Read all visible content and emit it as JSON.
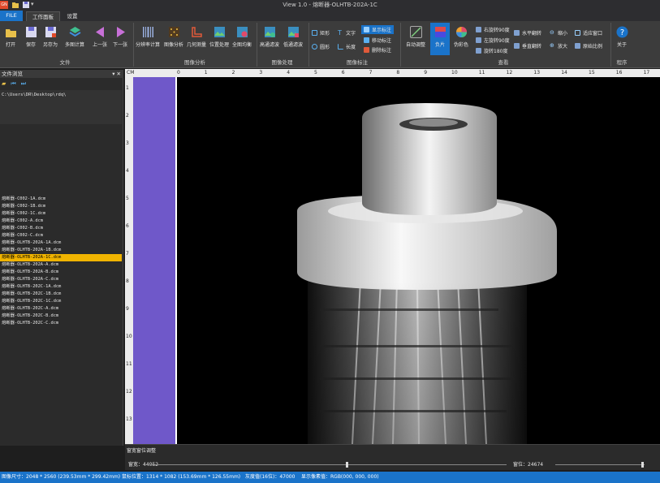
{
  "app": {
    "title": "View 1.0 - 熔断器-OLHTB-202A-1C",
    "logo_text": "GN"
  },
  "tabs": [
    {
      "label": "FILE"
    },
    {
      "label": "工作面板"
    },
    {
      "label": "设置"
    }
  ],
  "ribbon": {
    "file_group": {
      "label": "文件",
      "buttons": [
        {
          "label": "打开",
          "icon": "folder-open-icon"
        },
        {
          "label": "保存",
          "icon": "save-icon"
        },
        {
          "label": "另存为",
          "icon": "save-as-icon"
        },
        {
          "label": "多图计算",
          "icon": "layers-icon"
        },
        {
          "label": "上一张",
          "icon": "prev-icon"
        },
        {
          "label": "下一张",
          "icon": "next-icon"
        }
      ]
    },
    "analysis_group": {
      "label": "图像分析",
      "buttons": [
        {
          "label": "分辨率计算",
          "icon": "barcode-icon"
        },
        {
          "label": "图像分析",
          "icon": "grid-icon"
        },
        {
          "label": "几何测量",
          "icon": "ruler-icon"
        },
        {
          "label": "位置处理",
          "icon": "image-icon"
        },
        {
          "label": "全图均衡",
          "icon": "equalize-icon"
        }
      ]
    },
    "processing_group": {
      "label": "图像处理",
      "buttons": [
        {
          "label": "高通滤波",
          "icon": "highpass-icon"
        },
        {
          "label": "低通滤波",
          "icon": "lowpass-icon"
        }
      ]
    },
    "annotation_group": {
      "label": "图像标注",
      "items": [
        {
          "label": "矩形"
        },
        {
          "label": "圆形"
        },
        {
          "label": "文字"
        },
        {
          "label": "长度"
        },
        {
          "label": "显示标注"
        },
        {
          "label": "移动标注"
        },
        {
          "label": "删除标注"
        }
      ]
    },
    "view_group": {
      "label": "查看",
      "auto_adjust": "自动调整",
      "negative": "负片",
      "pseudo_color": "伪彩色",
      "items": [
        {
          "label": "右旋转90度"
        },
        {
          "label": "左旋转90度"
        },
        {
          "label": "旋转180度"
        },
        {
          "label": "水平翻转"
        },
        {
          "label": "垂直翻转"
        },
        {
          "label": "缩小"
        },
        {
          "label": "放大"
        },
        {
          "label": "适应窗口"
        },
        {
          "label": "原始比例"
        }
      ]
    },
    "program_group": {
      "label": "程序",
      "about": "关于"
    }
  },
  "file_panel": {
    "title": "文件浏览",
    "path": "C:\\Users\\DR\\Desktop\\rdq\\",
    "files": [
      {
        "name": "熔断器-C002-1A.dcm",
        "selected": false
      },
      {
        "name": "熔断器-C002-1B.dcm",
        "selected": false
      },
      {
        "name": "熔断器-C002-1C.dcm",
        "selected": false
      },
      {
        "name": "熔断器-C002-A.dcm",
        "selected": false
      },
      {
        "name": "熔断器-C002-B.dcm",
        "selected": false
      },
      {
        "name": "熔断器-C002-C.dcm",
        "selected": false
      },
      {
        "name": "熔断器-OLHTB-202A-1A.dcm",
        "selected": false
      },
      {
        "name": "熔断器-OLHTB-202A-1B.dcm",
        "selected": false
      },
      {
        "name": "熔断器-OLHTB-202A-1C.dcm",
        "selected": true
      },
      {
        "name": "熔断器-OLHTB-202A-A.dcm",
        "selected": false
      },
      {
        "name": "熔断器-OLHTB-202A-B.dcm",
        "selected": false
      },
      {
        "name": "熔断器-OLHTB-202A-C.dcm",
        "selected": false
      },
      {
        "name": "熔断器-OLHTB-202C-1A.dcm",
        "selected": false
      },
      {
        "name": "熔断器-OLHTB-202C-1B.dcm",
        "selected": false
      },
      {
        "name": "熔断器-OLHTB-202C-1C.dcm",
        "selected": false
      },
      {
        "name": "熔断器-OLHTB-202C-A.dcm",
        "selected": false
      },
      {
        "name": "熔断器-OLHTB-202C-B.dcm",
        "selected": false
      },
      {
        "name": "熔断器-OLHTB-202C-C.dcm",
        "selected": false
      }
    ]
  },
  "ruler": {
    "unit": "CM",
    "h_ticks": [
      "0",
      "1",
      "2",
      "3",
      "4",
      "5",
      "6",
      "7",
      "8",
      "9",
      "10",
      "11",
      "12",
      "13",
      "14",
      "15",
      "16",
      "17"
    ],
    "v_ticks": [
      "1",
      "2",
      "3",
      "4",
      "5",
      "6",
      "7",
      "8",
      "9",
      "10",
      "11",
      "12",
      "13"
    ]
  },
  "window_level": {
    "title": "窗宽窗位调整",
    "width_label": "窗宽：",
    "width_value": "44052",
    "level_label": "窗位：",
    "level_value": "24674",
    "width_slider": 0.55
  },
  "status": {
    "image_size": "图像尺寸：2048 * 2560 (239.53mm * 299.42mm)",
    "mouse_pos": "鼠标位置：1314 * 1082 (153.69mm * 126.55mm)",
    "gray_value": "灰度值(16位)：47000",
    "display_value": "显示像素值：RGB(000, 000, 000)"
  },
  "colors": {
    "accent": "#1a73c9",
    "selection": "#f0b400",
    "purple_bar": "#6f58c9"
  }
}
